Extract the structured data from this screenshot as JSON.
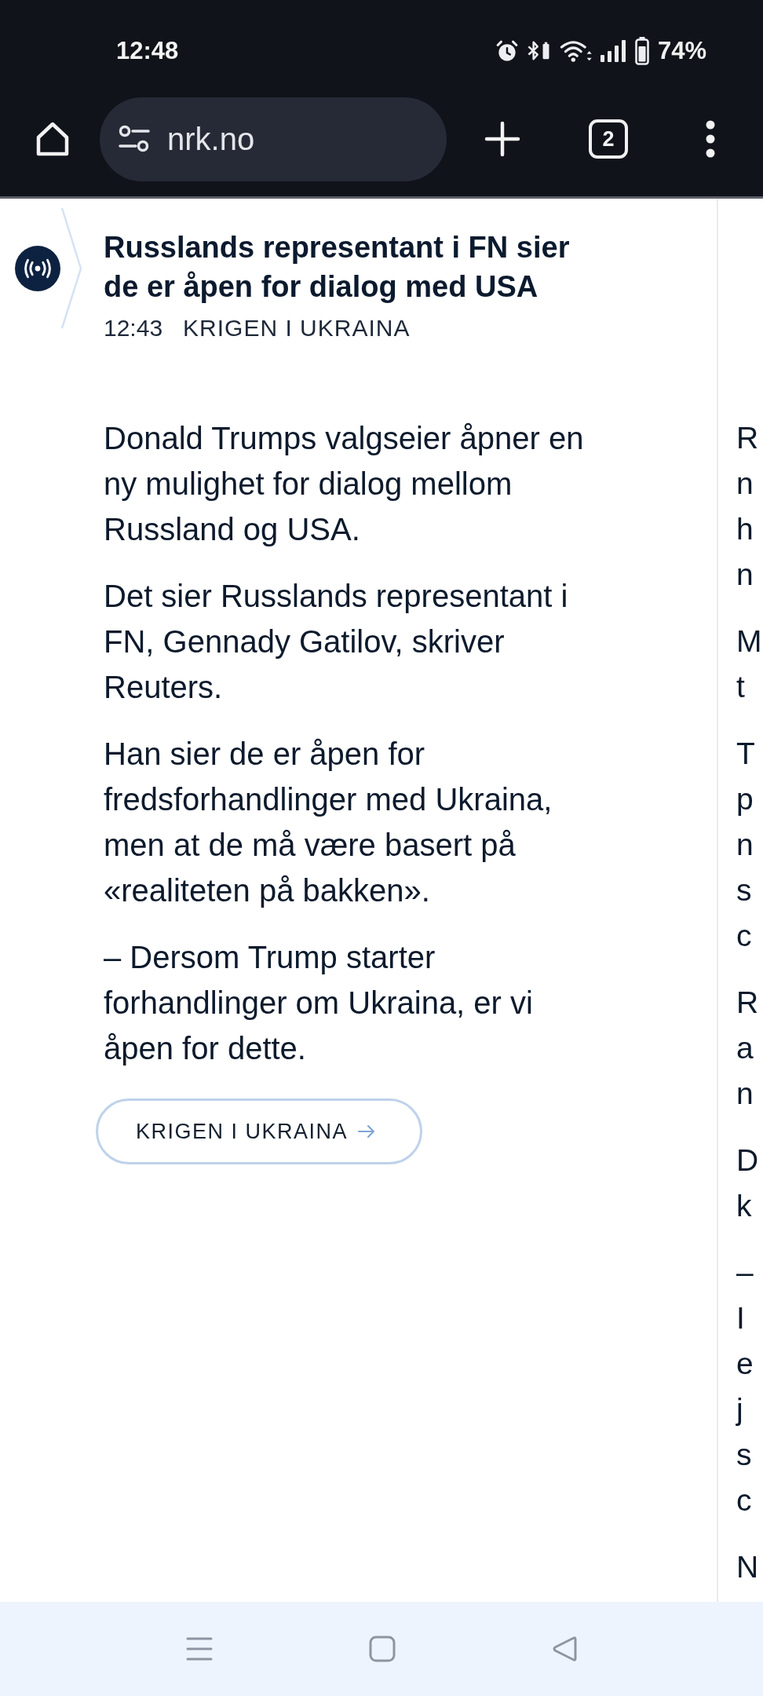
{
  "status_bar": {
    "time": "12:48",
    "battery": "74%"
  },
  "browser_toolbar": {
    "url": "nrk.no",
    "tab_count": "2"
  },
  "live_post": {
    "headline": "Russlands representant i FN sier de er åpen for dialog med USA",
    "time": "12:43",
    "category": "KRIGEN I UKRAINA",
    "paragraphs": [
      "Donald Trumps valgseier åpner en ny mulighet for dialog mellom Russland og USA.",
      "Det sier Russlands representant i FN, Gennady Gatilov, skriver Reuters.",
      "Han sier de er åpen for fredsforhandlinger med Ukraina, men at de må være basert på «realiteten på bakken».",
      "– Dersom Trump starter forhandlinger om Ukraina, er vi åpen for dette."
    ],
    "tag_link": "KRIGEN I UKRAINA"
  },
  "next_post": {
    "paragraphs": [
      [
        "R",
        "n",
        "h",
        "n"
      ],
      [
        "M",
        "t"
      ],
      [
        "T",
        "p",
        "n",
        "s",
        "c"
      ],
      [
        "R",
        "a",
        "n"
      ],
      [
        "D",
        "k"
      ],
      [
        "–",
        "I",
        "e",
        "j",
        "s",
        "c"
      ],
      [
        "N"
      ]
    ]
  }
}
